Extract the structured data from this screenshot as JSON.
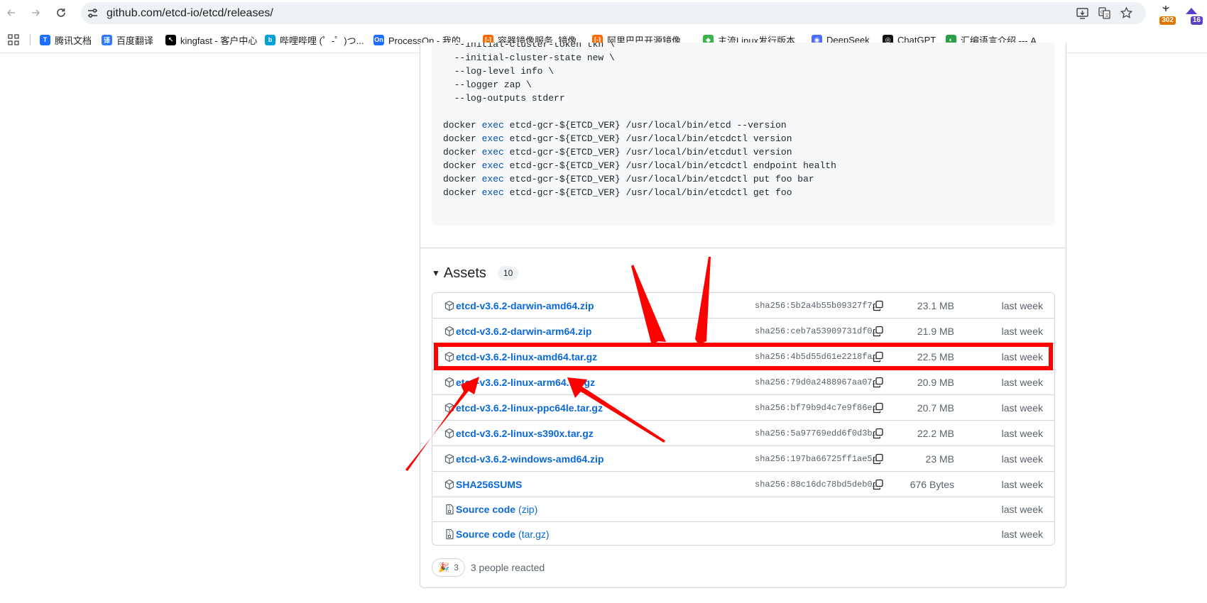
{
  "browser": {
    "url": "github.com/etcd-io/etcd/releases/",
    "extensions": [
      {
        "name": "extension-1",
        "badge": "302",
        "badge_color": "#e37400"
      },
      {
        "name": "extension-2",
        "badge": "16",
        "badge_color": "#5b3fc9"
      }
    ]
  },
  "bookmarks": [
    {
      "label": "腾讯文档",
      "color": "#1e6fff",
      "glyph": "T"
    },
    {
      "label": "百度翻译",
      "color": "#2f7cf6",
      "glyph": "译"
    },
    {
      "label": "kingfast - 客户中心",
      "color": "#000000",
      "glyph": "↖"
    },
    {
      "label": "哔哩哔哩 (゜-゜)つ...",
      "color": "#00a1d6",
      "glyph": "b"
    },
    {
      "label": "ProcessOn - 我的...",
      "color": "#1e6fff",
      "glyph": "On"
    },
    {
      "label": "容器镜像服务_镜像...",
      "color": "#ff6a00",
      "glyph": "[-]"
    },
    {
      "label": "阿里巴巴开源镜像...",
      "color": "#ff6a00",
      "glyph": "[-]"
    },
    {
      "label": "主流Linux发行版本...",
      "color": "#3bb44a",
      "glyph": "◆"
    },
    {
      "label": "DeepSeek",
      "color": "#4d6bfe",
      "glyph": "◉"
    },
    {
      "label": "ChatGPT",
      "color": "#111111",
      "glyph": "◎"
    },
    {
      "label": "汇编语言介绍 --- A...",
      "color": "#2e9e47",
      "glyph": "◐"
    }
  ],
  "code": {
    "lines": [
      {
        "parts": [
          {
            "t": "  --initial-cluster-token tkn \\"
          }
        ]
      },
      {
        "parts": [
          {
            "t": "  --initial-cluster-state new \\"
          }
        ]
      },
      {
        "parts": [
          {
            "t": "  --log-level info \\"
          }
        ]
      },
      {
        "parts": [
          {
            "t": "  --logger zap \\"
          }
        ]
      },
      {
        "parts": [
          {
            "t": "  --log-outputs stderr"
          }
        ]
      },
      {
        "parts": [
          {
            "t": ""
          }
        ]
      },
      {
        "parts": [
          {
            "t": "docker "
          },
          {
            "t": "exec",
            "kw": true
          },
          {
            "t": " etcd-gcr-${ETCD_VER} /usr/local/bin/etcd --version"
          }
        ]
      },
      {
        "parts": [
          {
            "t": "docker "
          },
          {
            "t": "exec",
            "kw": true
          },
          {
            "t": " etcd-gcr-${ETCD_VER} /usr/local/bin/etcdctl version"
          }
        ]
      },
      {
        "parts": [
          {
            "t": "docker "
          },
          {
            "t": "exec",
            "kw": true
          },
          {
            "t": " etcd-gcr-${ETCD_VER} /usr/local/bin/etcdutl version"
          }
        ]
      },
      {
        "parts": [
          {
            "t": "docker "
          },
          {
            "t": "exec",
            "kw": true
          },
          {
            "t": " etcd-gcr-${ETCD_VER} /usr/local/bin/etcdctl endpoint health"
          }
        ]
      },
      {
        "parts": [
          {
            "t": "docker "
          },
          {
            "t": "exec",
            "kw": true
          },
          {
            "t": " etcd-gcr-${ETCD_VER} /usr/local/bin/etcdctl put foo bar"
          }
        ]
      },
      {
        "parts": [
          {
            "t": "docker "
          },
          {
            "t": "exec",
            "kw": true
          },
          {
            "t": " etcd-gcr-${ETCD_VER} /usr/local/bin/etcdctl get foo"
          }
        ]
      }
    ]
  },
  "assets": {
    "title": "Assets",
    "count": "10",
    "items": [
      {
        "name": "etcd-v3.6.2-darwin-amd64.zip",
        "sha": "sha256:5b2a4b55b09327f7…",
        "size": "23.1 MB",
        "date": "last week",
        "icon": "package-icon"
      },
      {
        "name": "etcd-v3.6.2-darwin-arm64.zip",
        "sha": "sha256:ceb7a53909731df0…",
        "size": "21.9 MB",
        "date": "last week",
        "icon": "package-icon"
      },
      {
        "name": "etcd-v3.6.2-linux-amd64.tar.gz",
        "sha": "sha256:4b5d55d61e2218fa…",
        "size": "22.5 MB",
        "date": "last week",
        "icon": "package-icon",
        "highlighted": true
      },
      {
        "name": "etcd-v3.6.2-linux-arm64.tar.gz",
        "sha": "sha256:79d0a2488967aa07…",
        "size": "20.9 MB",
        "date": "last week",
        "icon": "package-icon"
      },
      {
        "name": "etcd-v3.6.2-linux-ppc64le.tar.gz",
        "sha": "sha256:bf79b9d4c7e9f86e…",
        "size": "20.7 MB",
        "date": "last week",
        "icon": "package-icon"
      },
      {
        "name": "etcd-v3.6.2-linux-s390x.tar.gz",
        "sha": "sha256:5a97769edd6f0d3b…",
        "size": "22.2 MB",
        "date": "last week",
        "icon": "package-icon"
      },
      {
        "name": "etcd-v3.6.2-windows-amd64.zip",
        "sha": "sha256:197ba66725ff1ae5…",
        "size": "23 MB",
        "date": "last week",
        "icon": "package-icon"
      },
      {
        "name": "SHA256SUMS",
        "sha": "sha256:88c16dc78bd5deb0…",
        "size": "676 Bytes",
        "date": "last week",
        "icon": "package-icon"
      },
      {
        "name": "Source code",
        "suffix": "(zip)",
        "date": "last week",
        "icon": "file-zip-icon"
      },
      {
        "name": "Source code",
        "suffix": "(tar.gz)",
        "date": "last week",
        "icon": "file-zip-icon"
      }
    ]
  },
  "reactions": {
    "emoji": "🎉",
    "count": "3",
    "summary": "3 people reacted"
  },
  "annotation": {
    "color": "#ff0000"
  }
}
